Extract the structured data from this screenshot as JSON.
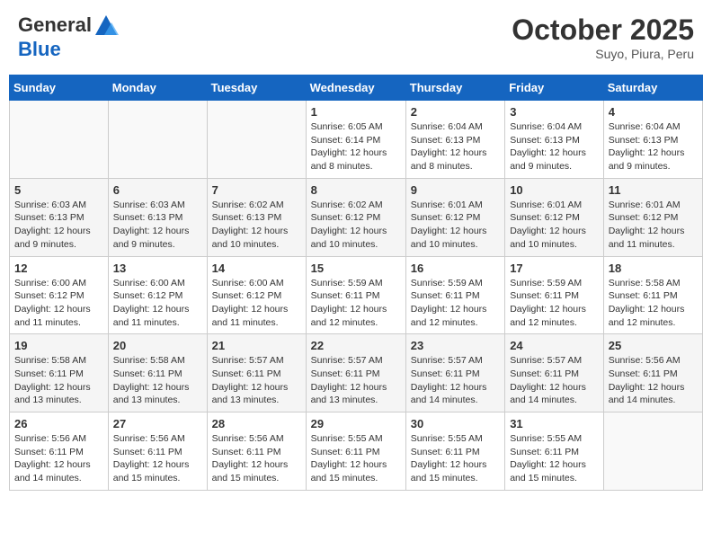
{
  "header": {
    "logo_line1": "General",
    "logo_line2": "Blue",
    "month": "October 2025",
    "location": "Suyo, Piura, Peru"
  },
  "days_of_week": [
    "Sunday",
    "Monday",
    "Tuesday",
    "Wednesday",
    "Thursday",
    "Friday",
    "Saturday"
  ],
  "weeks": [
    [
      {
        "day": "",
        "info": ""
      },
      {
        "day": "",
        "info": ""
      },
      {
        "day": "",
        "info": ""
      },
      {
        "day": "1",
        "info": "Sunrise: 6:05 AM\nSunset: 6:14 PM\nDaylight: 12 hours\nand 8 minutes."
      },
      {
        "day": "2",
        "info": "Sunrise: 6:04 AM\nSunset: 6:13 PM\nDaylight: 12 hours\nand 8 minutes."
      },
      {
        "day": "3",
        "info": "Sunrise: 6:04 AM\nSunset: 6:13 PM\nDaylight: 12 hours\nand 9 minutes."
      },
      {
        "day": "4",
        "info": "Sunrise: 6:04 AM\nSunset: 6:13 PM\nDaylight: 12 hours\nand 9 minutes."
      }
    ],
    [
      {
        "day": "5",
        "info": "Sunrise: 6:03 AM\nSunset: 6:13 PM\nDaylight: 12 hours\nand 9 minutes."
      },
      {
        "day": "6",
        "info": "Sunrise: 6:03 AM\nSunset: 6:13 PM\nDaylight: 12 hours\nand 9 minutes."
      },
      {
        "day": "7",
        "info": "Sunrise: 6:02 AM\nSunset: 6:13 PM\nDaylight: 12 hours\nand 10 minutes."
      },
      {
        "day": "8",
        "info": "Sunrise: 6:02 AM\nSunset: 6:12 PM\nDaylight: 12 hours\nand 10 minutes."
      },
      {
        "day": "9",
        "info": "Sunrise: 6:01 AM\nSunset: 6:12 PM\nDaylight: 12 hours\nand 10 minutes."
      },
      {
        "day": "10",
        "info": "Sunrise: 6:01 AM\nSunset: 6:12 PM\nDaylight: 12 hours\nand 10 minutes."
      },
      {
        "day": "11",
        "info": "Sunrise: 6:01 AM\nSunset: 6:12 PM\nDaylight: 12 hours\nand 11 minutes."
      }
    ],
    [
      {
        "day": "12",
        "info": "Sunrise: 6:00 AM\nSunset: 6:12 PM\nDaylight: 12 hours\nand 11 minutes."
      },
      {
        "day": "13",
        "info": "Sunrise: 6:00 AM\nSunset: 6:12 PM\nDaylight: 12 hours\nand 11 minutes."
      },
      {
        "day": "14",
        "info": "Sunrise: 6:00 AM\nSunset: 6:12 PM\nDaylight: 12 hours\nand 11 minutes."
      },
      {
        "day": "15",
        "info": "Sunrise: 5:59 AM\nSunset: 6:11 PM\nDaylight: 12 hours\nand 12 minutes."
      },
      {
        "day": "16",
        "info": "Sunrise: 5:59 AM\nSunset: 6:11 PM\nDaylight: 12 hours\nand 12 minutes."
      },
      {
        "day": "17",
        "info": "Sunrise: 5:59 AM\nSunset: 6:11 PM\nDaylight: 12 hours\nand 12 minutes."
      },
      {
        "day": "18",
        "info": "Sunrise: 5:58 AM\nSunset: 6:11 PM\nDaylight: 12 hours\nand 12 minutes."
      }
    ],
    [
      {
        "day": "19",
        "info": "Sunrise: 5:58 AM\nSunset: 6:11 PM\nDaylight: 12 hours\nand 13 minutes."
      },
      {
        "day": "20",
        "info": "Sunrise: 5:58 AM\nSunset: 6:11 PM\nDaylight: 12 hours\nand 13 minutes."
      },
      {
        "day": "21",
        "info": "Sunrise: 5:57 AM\nSunset: 6:11 PM\nDaylight: 12 hours\nand 13 minutes."
      },
      {
        "day": "22",
        "info": "Sunrise: 5:57 AM\nSunset: 6:11 PM\nDaylight: 12 hours\nand 13 minutes."
      },
      {
        "day": "23",
        "info": "Sunrise: 5:57 AM\nSunset: 6:11 PM\nDaylight: 12 hours\nand 14 minutes."
      },
      {
        "day": "24",
        "info": "Sunrise: 5:57 AM\nSunset: 6:11 PM\nDaylight: 12 hours\nand 14 minutes."
      },
      {
        "day": "25",
        "info": "Sunrise: 5:56 AM\nSunset: 6:11 PM\nDaylight: 12 hours\nand 14 minutes."
      }
    ],
    [
      {
        "day": "26",
        "info": "Sunrise: 5:56 AM\nSunset: 6:11 PM\nDaylight: 12 hours\nand 14 minutes."
      },
      {
        "day": "27",
        "info": "Sunrise: 5:56 AM\nSunset: 6:11 PM\nDaylight: 12 hours\nand 15 minutes."
      },
      {
        "day": "28",
        "info": "Sunrise: 5:56 AM\nSunset: 6:11 PM\nDaylight: 12 hours\nand 15 minutes."
      },
      {
        "day": "29",
        "info": "Sunrise: 5:55 AM\nSunset: 6:11 PM\nDaylight: 12 hours\nand 15 minutes."
      },
      {
        "day": "30",
        "info": "Sunrise: 5:55 AM\nSunset: 6:11 PM\nDaylight: 12 hours\nand 15 minutes."
      },
      {
        "day": "31",
        "info": "Sunrise: 5:55 AM\nSunset: 6:11 PM\nDaylight: 12 hours\nand 15 minutes."
      },
      {
        "day": "",
        "info": ""
      }
    ]
  ]
}
